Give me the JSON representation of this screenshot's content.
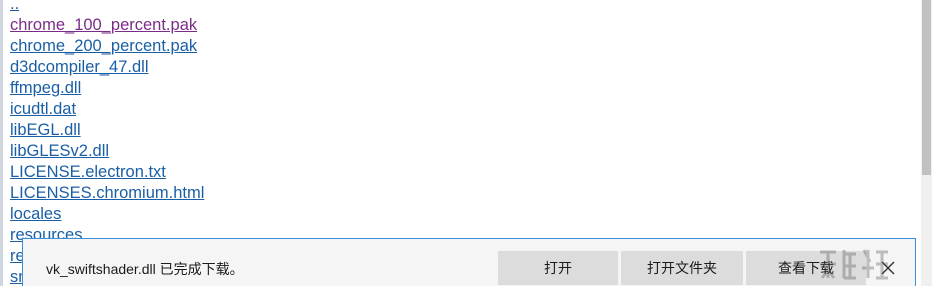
{
  "file_listing": {
    "parent_link": "..",
    "entries": [
      "chrome_100_percent.pak",
      "chrome_200_percent.pak",
      "d3dcompiler_47.dll",
      "ffmpeg.dll",
      "icudtl.dat",
      "libEGL.dll",
      "libGLESv2.dll",
      "LICENSE.electron.txt",
      "LICENSES.chromium.html",
      "locales",
      "resources",
      "re",
      "sn"
    ]
  },
  "download_bar": {
    "message": "vk_swiftshader.dll 已完成下载。",
    "open_label": "打开",
    "open_folder_label": "打开文件夹",
    "view_downloads_label": "查看下载",
    "close_icon": "close-icon"
  },
  "colors": {
    "link": "#1a5fa6",
    "visited_link": "#7b2d89",
    "accent_border": "#3d8ed8",
    "button_bg": "#dcdcdc"
  }
}
